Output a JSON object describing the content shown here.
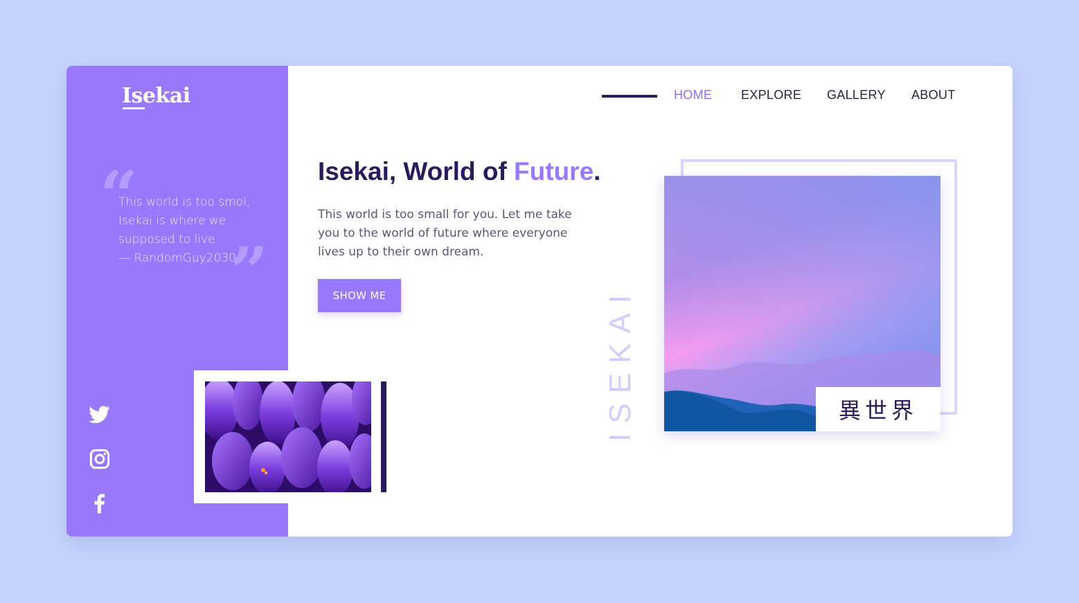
{
  "brand": {
    "logo": "Isekai"
  },
  "quote": {
    "text": "This world is too smol, Isekai is where we supposed to live.",
    "author": "— RandomGuy2030"
  },
  "nav": {
    "items": [
      {
        "label": "HOME",
        "active": true
      },
      {
        "label": "EXPLORE",
        "active": false
      },
      {
        "label": "GALLERY",
        "active": false
      },
      {
        "label": "ABOUT",
        "active": false
      }
    ]
  },
  "hero": {
    "title_main": "Isekai, World of ",
    "title_accent": "Future",
    "title_end": ".",
    "body": "This world is too small for you. Let me take you to the world of future where everyone lives up to their own dream.",
    "cta_label": "SHOW ME",
    "vertical_word": "ISEKAI",
    "kanji": "異世界"
  },
  "social": {
    "icons": [
      "twitter-icon",
      "instagram-icon",
      "facebook-icon"
    ]
  },
  "colors": {
    "background": "#c5d3fd",
    "sidebar": "#9a78fc",
    "accent": "#9a78fc",
    "dark": "#2b1b5c"
  }
}
